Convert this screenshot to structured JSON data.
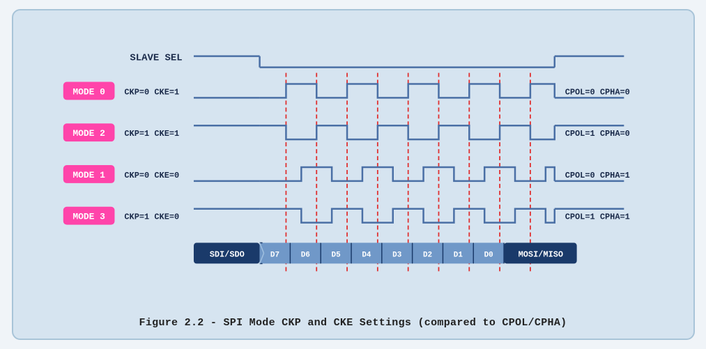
{
  "caption": "Figure 2.2 - SPI Mode CKP and CKE Settings (compared to CPOL/CPHA)",
  "diagram": {
    "slavesel_label": "SLAVE SEL",
    "modes": [
      {
        "label": "MODE 0",
        "params": "CKP=0  CKE=1",
        "right": "CPOL=0  CPHA=0"
      },
      {
        "label": "MODE 2",
        "params": "CKP=1  CKE=1",
        "right": "CPOL=1  CPHA=0"
      },
      {
        "label": "MODE 1",
        "params": "CKP=0  CKE=0",
        "right": "CPOL=0  CPHA=1"
      },
      {
        "label": "MODE 3",
        "params": "CKP=1  CKE=0",
        "right": "CPOL=1  CPHA=1"
      }
    ],
    "data_labels": [
      "SDI/SDO",
      "D7",
      "D6",
      "D5",
      "D4",
      "D3",
      "D2",
      "D1",
      "D0",
      "MOSI/MISO"
    ]
  }
}
